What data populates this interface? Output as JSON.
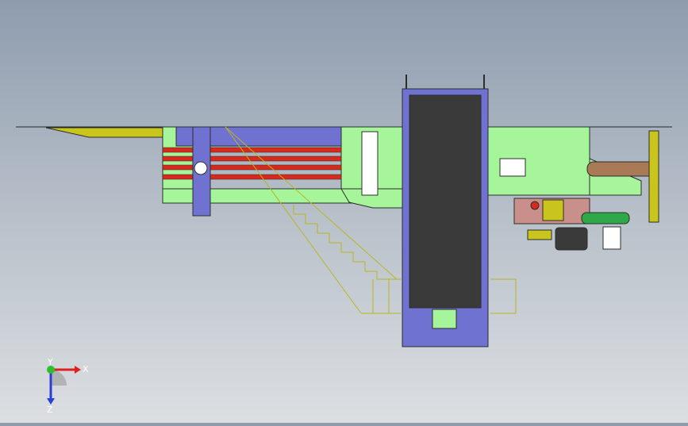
{
  "viewport": {
    "background_top": "#8e9cae",
    "background_bottom": "#dcdfe2"
  },
  "triad": {
    "x_label": "X",
    "y_label": "Y",
    "z_label": "Z",
    "x_color": "#e0201c",
    "y_color": "#2bbf2b",
    "z_color": "#2a3ed8"
  },
  "model": {
    "colors": {
      "green": "#a6f59a",
      "blue": "#6f72d1",
      "red": "#d82a1c",
      "yellow": "#c9c51c",
      "pink": "#c98f8a",
      "brown": "#a87a56",
      "dark": "#3a3a3a",
      "outline": "#2b2f2b"
    },
    "components": [
      "baler-body",
      "feed-chute",
      "compression-cylinders",
      "stair-access",
      "conveyor",
      "hydraulic-station",
      "motor",
      "oil-cooler",
      "discharge-pipe"
    ]
  }
}
